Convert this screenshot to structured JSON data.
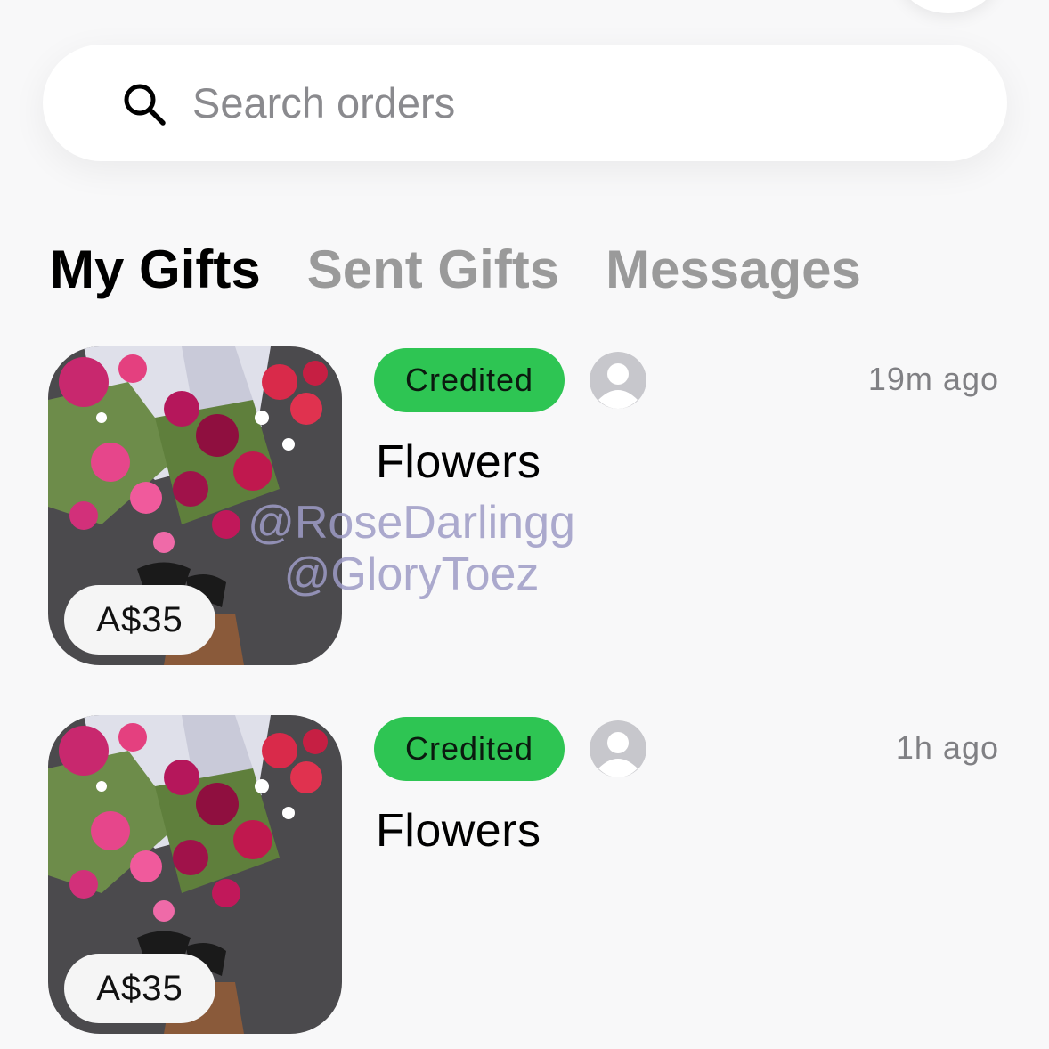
{
  "search": {
    "placeholder": "Search orders"
  },
  "tabs": [
    {
      "label": "My Gifts",
      "active": true
    },
    {
      "label": "Sent Gifts",
      "active": false
    },
    {
      "label": "Messages",
      "active": false
    }
  ],
  "orders": [
    {
      "price": "A$35",
      "status": "Credited",
      "time": "19m ago",
      "title": "Flowers"
    },
    {
      "price": "A$35",
      "status": "Credited",
      "time": "1h ago",
      "title": "Flowers"
    }
  ],
  "watermark": {
    "line1": "@RoseDarlingg",
    "line2": "@GloryToez"
  },
  "colors": {
    "status_green": "#2ec553",
    "tab_active": "#000000",
    "tab_inactive": "#9a9a9a",
    "background": "#f8f8f9"
  },
  "icons": {
    "search": "search-icon",
    "avatar": "default-avatar-icon"
  }
}
